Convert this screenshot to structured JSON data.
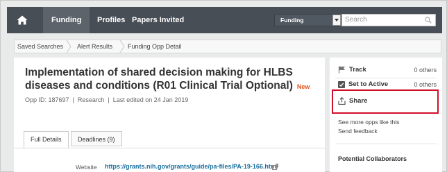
{
  "nav": {
    "tabs": [
      "Funding",
      "Profiles",
      "Papers Invited"
    ],
    "scope_value": "Funding",
    "search_placeholder": "Search"
  },
  "breadcrumb": [
    "Saved Searches",
    "Alert Results",
    "Funding Opp Detail"
  ],
  "opportunity": {
    "title": "Implementation of shared decision making for HLBS diseases and conditions (R01 Clinical Trial Optional)",
    "badge": "New",
    "meta": "Opp ID: 187697  |  Research  |  Last edited on 24 Jan 2019",
    "tabs": [
      "Full Details",
      "Deadlines (9)"
    ],
    "website_label": "Website",
    "website_url": "https://grants.nih.gov/grants/guide/pa-files/PA-19-166.html"
  },
  "side": {
    "track_label": "Track",
    "track_count": "0 others",
    "active_label": "Set to Active",
    "active_count": "0 others",
    "share_label": "Share",
    "more_link": "See more opps like this",
    "feedback_link": "Send feedback",
    "collaborators_label": "Potential Collaborators"
  },
  "colors": {
    "nav_bg": "#474e56",
    "link": "#1a6e9e",
    "new_badge": "#e2541d",
    "highlight_box": "#d0102b"
  }
}
